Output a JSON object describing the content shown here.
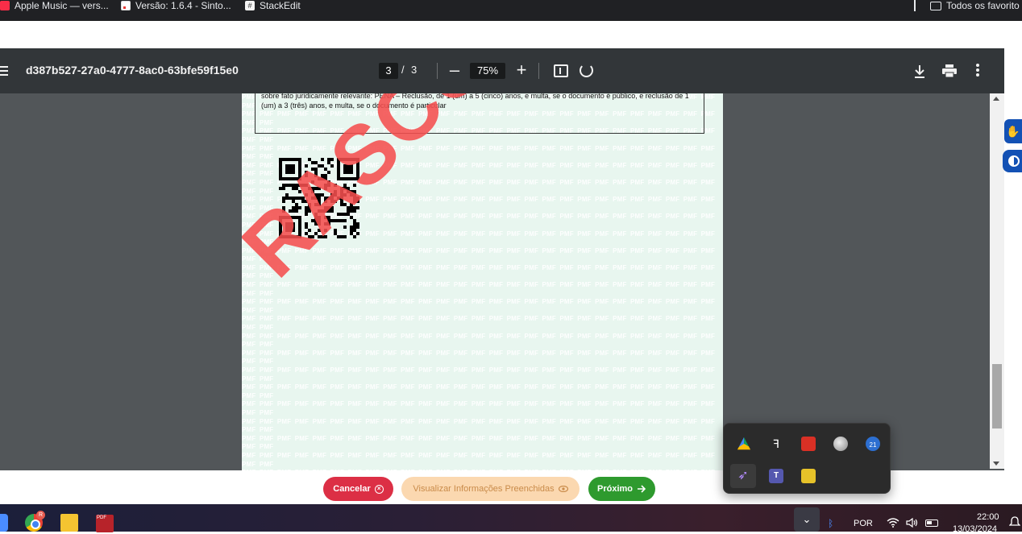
{
  "bookmarks": {
    "items": [
      {
        "label": "Apple Music — vers..."
      },
      {
        "label": "Versão: 1.6.4 - Sinto..."
      },
      {
        "label": "StackEdit"
      }
    ],
    "all_bookmarks": "Todos os favorito"
  },
  "pdf_viewer": {
    "document_title": "d387b527-27a0-4777-8ac0-63bfe59f15e0",
    "current_page": "3",
    "page_separator": "/",
    "total_pages": "3",
    "zoom_level": "75%",
    "zoom_out_symbol": "–",
    "zoom_in_symbol": "+"
  },
  "document": {
    "legal_text": "sobre fato juridicamente relevante: PENA – Reclusão, de 1 (um) a 5 (cinco) anos, e multa, se o documento é público, e reclusão de 1 (um) a 3 (três) anos, e multa, se o documento é particular",
    "watermark_word": "PMF",
    "stamp_text": "RASCUNHO"
  },
  "actions": {
    "cancel_label": "Cancelar",
    "view_filled_label": "Visualizar Informações Preenchidas",
    "next_label": "Próximo"
  },
  "tray_popup": {
    "icons": [
      "google-drive-icon",
      "figma-icon",
      "screen-recorder-icon",
      "globe-icon",
      "notification-count-icon",
      "feather-icon",
      "teams-icon",
      "vpn-lock-icon"
    ],
    "count_badge": "21",
    "teams_letter": "T"
  },
  "taskbar": {
    "chrome_badge": "R",
    "pdf_label": "PDF",
    "language": "POR",
    "time": "22:00",
    "date": "13/03/2024"
  },
  "colors": {
    "cancel": "#dc2f45",
    "view_filled": "#fbd8b0",
    "next": "#2e9a2e",
    "stamp": "#f44e4e",
    "page_bg": "#e8f6ef"
  }
}
